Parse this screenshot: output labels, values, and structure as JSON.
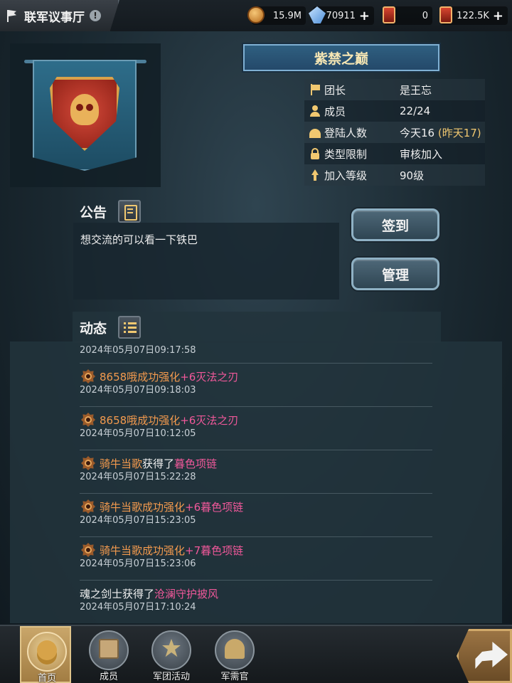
{
  "topbar": {
    "title": "联军议事厅",
    "info": "!",
    "resources": [
      {
        "icon": "coin-icon",
        "value": "15.9M",
        "plus": false
      },
      {
        "icon": "crystal-icon",
        "value": "70911",
        "plus": true
      },
      {
        "icon": "card-icon",
        "value": "0",
        "plus": false
      },
      {
        "icon": "card-icon",
        "value": "122.5K",
        "plus": true
      }
    ],
    "plus_symbol": "+"
  },
  "guild": {
    "name": "紫禁之巅",
    "rows": [
      {
        "icon": "small-flag-icon",
        "label": "团长",
        "value": "是王忘",
        "extra": ""
      },
      {
        "icon": "person-icon",
        "label": "成员",
        "value": "22/24",
        "extra": ""
      },
      {
        "icon": "group-icon",
        "label": "登陆人数",
        "value": "今天16 ",
        "extra": "(昨天17)"
      },
      {
        "icon": "lock-icon",
        "label": "类型限制",
        "value": "审核加入",
        "extra": ""
      },
      {
        "icon": "arrow-up-icon",
        "label": "加入等级",
        "value": "90级",
        "extra": ""
      }
    ]
  },
  "notice": {
    "title": "公告",
    "text": "想交流的可以看一下铁巴"
  },
  "buttons": {
    "checkin": "签到",
    "manage": "管理"
  },
  "feed": {
    "title": "动态",
    "items": [
      {
        "badge": false,
        "name": "",
        "action": "",
        "item": "",
        "time": "2024年05月07日09:17:58"
      },
      {
        "badge": true,
        "name": "8658哦",
        "action": "成功强化",
        "item": "+6灭法之刃",
        "time": "2024年05月07日09:18:03"
      },
      {
        "badge": true,
        "name": "8658哦",
        "action": "成功强化",
        "item": "+6灭法之刃",
        "time": "2024年05月07日10:12:05"
      },
      {
        "badge": true,
        "name": "骑牛当歌",
        "action": "获得了",
        "item": "暮色项链",
        "time": "2024年05月07日15:22:28"
      },
      {
        "badge": true,
        "name": "骑牛当歌",
        "action": "成功强化",
        "item": "+6暮色项链",
        "time": "2024年05月07日15:23:05"
      },
      {
        "badge": true,
        "name": "骑牛当歌",
        "action": "成功强化",
        "item": "+7暮色项链",
        "time": "2024年05月07日15:23:06"
      },
      {
        "badge": false,
        "name": "魂之剑士",
        "action": "获得了",
        "item": "沧澜守护披风",
        "time": "2024年05月07日17:10:24"
      }
    ]
  },
  "nav": [
    {
      "label": "首页",
      "icon": "coins-icon",
      "active": true
    },
    {
      "label": "成员",
      "icon": "book-icon",
      "active": false
    },
    {
      "label": "军团活动",
      "icon": "star-icon",
      "active": false
    },
    {
      "label": "军需官",
      "icon": "helm-icon",
      "active": false
    }
  ],
  "colors": {
    "accent_gold": "#f1c870",
    "player_name": "#f39a4e",
    "item_pink": "#f0589a"
  }
}
